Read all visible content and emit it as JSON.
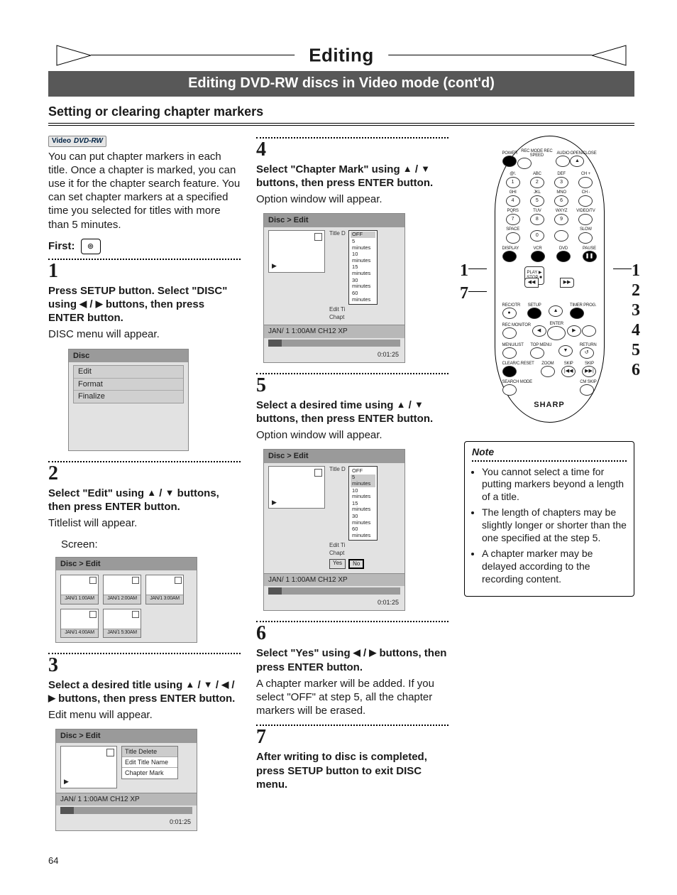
{
  "page_number": "64",
  "banner_title": "Editing",
  "subbanner": "Editing DVD-RW discs in Video mode (cont'd)",
  "section_title": "Setting or clearing chapter markers",
  "badge": {
    "top": "Video",
    "bottom": "DVD-RW"
  },
  "intro": "You can put chapter markers in each title. Once a chapter is marked, you can use it for the chapter search feature. You can set chapter markers at a specified time you selected for titles with more than 5 minutes.",
  "first_label": "First:",
  "steps": {
    "s1": {
      "num": "1",
      "instr_pre": "Press SETUP button. Select \"DISC\" using ",
      "instr_post": " buttons, then press ENTER button.",
      "after": "DISC menu will appear.",
      "panel_title": "Disc",
      "menu": [
        "Edit",
        "Format",
        "Finalize"
      ]
    },
    "s2": {
      "num": "2",
      "instr_pre": "Select \"Edit\" using ",
      "instr_post": " buttons, then press ENTER button.",
      "after": "Titlelist will appear.",
      "screen_label": "Screen:",
      "panel_title": "Disc > Edit",
      "thumbs": [
        "JAN/1  1:00AM",
        "JAN/1  2:00AM",
        "JAN/1  3:00AM",
        "JAN/1  4:00AM",
        "JAN/1  5:30AM"
      ]
    },
    "s3": {
      "num": "3",
      "instr_pre": "Select a desired title using ",
      "instr_post": " buttons, then press ENTER button.",
      "after": "Edit menu will appear.",
      "panel_title": "Disc > Edit",
      "side_menu": [
        "Title Delete",
        "Edit Title Name",
        "Chapter Mark"
      ],
      "status": "JAN/ 1   1:00AM  CH12     XP",
      "timecode": "0:01:25"
    },
    "s4": {
      "num": "4",
      "instr_pre": "Select \"Chapter Mark\" using ",
      "instr_post": " buttons, then press ENTER button.",
      "after": "Option window will appear.",
      "panel_title": "Disc > Edit",
      "labels": [
        "Title D",
        "Edit Ti",
        "Chapt"
      ],
      "popup": [
        "OFF",
        "5 minutes",
        "10 minutes",
        "15 minutes",
        "30 minutes",
        "60 minutes"
      ],
      "status": "JAN/ 1   1:00AM  CH12     XP",
      "timecode": "0:01:25"
    },
    "s5": {
      "num": "5",
      "instr_pre": "Select a desired time using ",
      "instr_post": " buttons, then press ENTER button.",
      "after": "Option window will appear.",
      "panel_title": "Disc > Edit",
      "labels": [
        "Title D",
        "Edit Ti",
        "Chapt"
      ],
      "popup": [
        "OFF",
        "5 minutes",
        "10 minutes",
        "15 minutes",
        "30 minutes",
        "60 minutes"
      ],
      "yes": "Yes",
      "no": "No",
      "status": "JAN/ 1   1:00AM  CH12     XP",
      "timecode": "0:01:25"
    },
    "s6": {
      "num": "6",
      "instr_pre": "Select \"Yes\" using ",
      "instr_post": " buttons, then press ENTER button.",
      "body": "A chapter marker will be added. If you select \"OFF\" at step 5, all the chapter markers will be erased."
    },
    "s7": {
      "num": "7",
      "instr": "After writing to disc is completed, press SETUP button to exit DISC menu."
    }
  },
  "remote": {
    "brand": "SHARP",
    "toprow": [
      "POWER",
      "REC MODE REC SPEED",
      "AUDIO",
      "OPEN/CLOSE"
    ],
    "numpad": [
      [
        "@!.",
        "1"
      ],
      [
        "ABC",
        "2"
      ],
      [
        "DEF",
        "3"
      ],
      [
        "CH +",
        ""
      ],
      [
        "GHI",
        "4"
      ],
      [
        "JKL",
        "5"
      ],
      [
        "MNO",
        "6"
      ],
      [
        "CH -",
        ""
      ],
      [
        "PQRS",
        "7"
      ],
      [
        "TUV",
        "8"
      ],
      [
        "WXYZ",
        "9"
      ],
      [
        "VIDEO/TV",
        ""
      ],
      [
        "SPACE",
        ""
      ],
      [
        "",
        "0"
      ],
      [
        "",
        ""
      ],
      [
        "SLOW",
        ""
      ]
    ],
    "row_a": [
      "DISPLAY",
      "VCR",
      "DVD",
      "PAUSE"
    ],
    "dpad": {
      "play": "PLAY ▶",
      "stop": "STOP ■",
      "left": "◀◀",
      "right": "▶▶"
    },
    "row_b": [
      "REC/OTR",
      "SETUP",
      "",
      "TIMER PROG."
    ],
    "row_c": [
      "REC MONITOR",
      "ENTER",
      "",
      "",
      ""
    ],
    "row_d": [
      "MENU/LIST",
      "TOP MENU",
      "",
      "RETURN"
    ],
    "row_e": [
      "CLEAR/C.RESET",
      "ZOOM",
      "SKIP",
      "SKIP"
    ],
    "row_f": [
      "SEARCH MODE",
      "CM SKIP",
      "|◀◀",
      "▶▶|"
    ],
    "callouts_left": [
      "1",
      "7"
    ],
    "callouts_right": [
      "1",
      "2",
      "3",
      "4",
      "5",
      "6"
    ]
  },
  "note": {
    "title": "Note",
    "items": [
      "You cannot select a time for putting markers beyond a length of a title.",
      "The length of chapters may be slightly longer or shorter than the one specified at the step 5.",
      "A chapter marker may be delayed according to the recording content."
    ]
  }
}
